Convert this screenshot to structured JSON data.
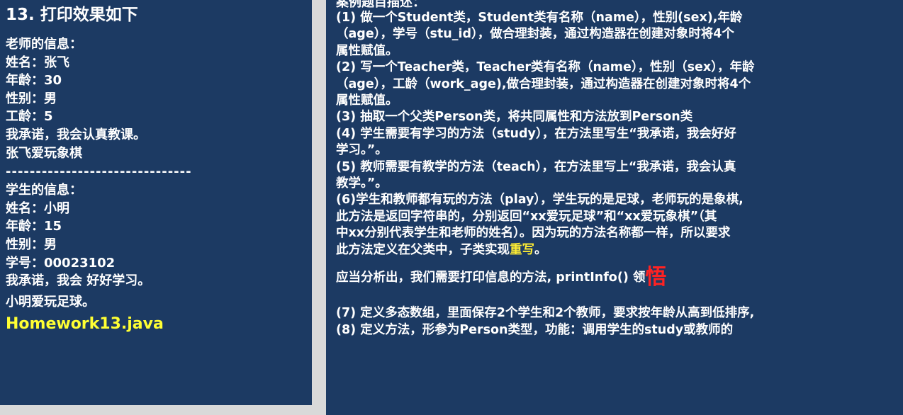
{
  "left": {
    "heading": "13. 打印效果如下",
    "teacher_title": "老师的信息：",
    "teacher_lines": [
      "姓名：张飞",
      "年龄：30",
      "性别：男",
      "工龄：5",
      "我承诺，我会认真教课。",
      "张飞爱玩象棋"
    ],
    "separator": "-------------------------------",
    "student_title": "学生的信息：",
    "student_lines": [
      "姓名：小明",
      "年龄：15",
      "性别：男",
      "学号：00023102"
    ],
    "student_promise": "我承诺，我会 好好学习。",
    "student_play": "小明爱玩足球。",
    "filename": "Homework13.java"
  },
  "right": {
    "title": "案例题目描述：",
    "lines": [
      "(1) 做一个Student类，Student类有名称（name），性别(sex),年龄",
      "（age），学号（stu_id），做合理封装，通过构造器在创建对象时将4个",
      "属性赋值。",
      "(2) 写一个Teacher类，Teacher类有名称（name），性别（sex），年龄",
      "（age），工龄（work_age),做合理封装，通过构造器在创建对象时将4个",
      "属性赋值。",
      "(3) 抽取一个父类Person类，将共同属性和方法放到Person类",
      "(4) 学生需要有学习的方法（study），在方法里写生“我承诺，我会好好",
      "学习。”。",
      "(5) 教师需要有教学的方法（teach），在方法里写上“我承诺，我会认真",
      "教学。”。",
      "(6)学生和教师都有玩的方法（play），学生玩的是足球，老师玩的是象棋,",
      "此方法是返回字符串的，分别返回“xx爱玩足球”和“xx爱玩象棋”（其",
      "中xx分别代表学生和老师的姓名）。因为玩的方法名称都一样，所以要求"
    ],
    "last_line_prefix": "此方法定义在父类中，子类实现",
    "last_line_highlight": "重写",
    "last_line_suffix": "。",
    "insight_text": "应当分析出，我们需要打印信息的方法, printInfo() 领",
    "insight_big": "悟",
    "bottom_lines": [
      "(7) 定义多态数组，里面保存2个学生和2个教师，要求按年龄从高到低排序,",
      "(8) 定义方法，形参为Person类型，功能：调用学生的study或教师的"
    ]
  },
  "colors": {
    "panel_bg": "#1c3a63",
    "text": "#ffffff",
    "filename": "#ffff33",
    "highlight": "#ffee33",
    "emphasis": "#ff2222"
  }
}
